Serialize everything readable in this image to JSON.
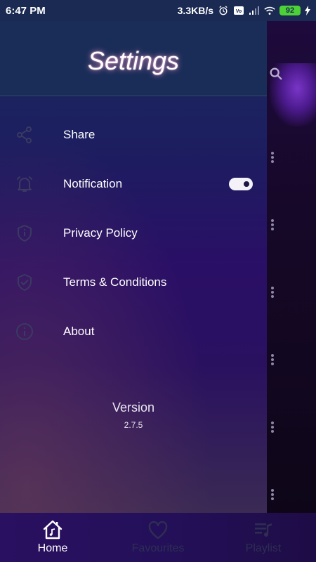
{
  "status_bar": {
    "time": "6:47 PM",
    "network_speed": "3.3KB/s",
    "battery": "92"
  },
  "drawer": {
    "title": "Settings",
    "items": [
      {
        "label": "Share",
        "icon": "share-icon"
      },
      {
        "label": "Notification",
        "icon": "alarm-bell-icon",
        "toggle_on": true
      },
      {
        "label": "Privacy Policy",
        "icon": "shield-info-icon"
      },
      {
        "label": "Terms & Conditions",
        "icon": "shield-check-icon"
      },
      {
        "label": "About",
        "icon": "info-icon"
      }
    ],
    "version_label": "Version",
    "version_number": "2.7.5"
  },
  "bottom_nav": {
    "items": [
      {
        "label": "Home",
        "icon": "home-music-icon",
        "active": true
      },
      {
        "label": "Favourites",
        "icon": "heart-icon",
        "active": false
      },
      {
        "label": "Playlist",
        "icon": "playlist-icon",
        "active": false
      }
    ]
  },
  "colors": {
    "accent_glow": "#ff9fd0",
    "toggle_track": "#f4f2f8",
    "active_nav": "#ffffff",
    "inactive_nav": "#3a3a5a"
  }
}
